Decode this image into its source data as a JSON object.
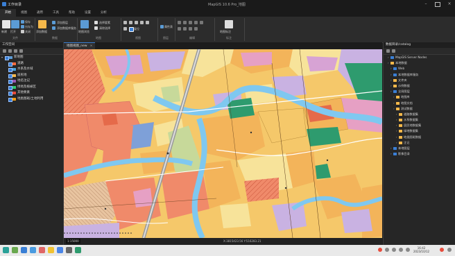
{
  "window": {
    "app_title": "工作目录",
    "doc_title": "MapGIS 10.6 Pro_地图"
  },
  "ribbon_tabs": [
    {
      "label": "开始",
      "active": true
    },
    {
      "label": "视图"
    },
    {
      "label": "通用"
    },
    {
      "label": "工具"
    },
    {
      "label": "帮助"
    },
    {
      "label": "设置"
    },
    {
      "label": "分析"
    }
  ],
  "ribbon": {
    "g1": {
      "btn1": "新建",
      "btn2": "打开",
      "s1": "保存",
      "s2": "另存为",
      "s3": "关闭",
      "name": "文件"
    },
    "g2": {
      "btn1": "添加数据",
      "s1": "添加图层",
      "s2": "添加数据库服务",
      "name": "数据"
    },
    "g3": {
      "btn1": "地图浏览",
      "s1": "选择要素",
      "s2": "清除选择",
      "name": "地图"
    },
    "g4": {
      "s1": "放大",
      "s2": "缩小",
      "s3": "复位",
      "name": "视图"
    },
    "g5": {
      "btn1": "属性表",
      "name": "图层"
    },
    "g6": {
      "name": "编辑"
    },
    "g7": {
      "btn1": "地图标注",
      "name": "标注"
    }
  },
  "left_panel": {
    "title": "工作空间",
    "map_name": "新地图",
    "layers": [
      {
        "label": "道路",
        "color": "#ff6b3d"
      },
      {
        "label": "水系及水域",
        "color": "#4aa3df"
      },
      {
        "label": "居民地",
        "color": "#f5b84a"
      },
      {
        "label": "地名注记",
        "color": "#9b59b6"
      },
      {
        "label": "绿地及植被区",
        "color": "#2ecc71"
      },
      {
        "label": "其他要素",
        "color": "#e74c3c"
      },
      {
        "label": "地类图斑/土地利用",
        "color": "#f39c12"
      }
    ]
  },
  "map": {
    "tab_label": "地图视图_new",
    "scale": "1:15000",
    "coords": "X:3815423.56 Y:516283.21"
  },
  "right_panel": {
    "title": "数据目录/catalog",
    "items": [
      {
        "label": "MapGIS Server Nodes",
        "indent": 1,
        "color": "#3a7fd5"
      },
      {
        "label": "本地数据",
        "indent": 1,
        "color": "#f5b84a"
      },
      {
        "label": "Web",
        "indent": 2,
        "color": "#3a7fd5"
      },
      {
        "label": "本地数据库服务",
        "indent": 2,
        "color": "#3a7fd5"
      },
      {
        "label": "文件夹",
        "indent": 2,
        "color": "#f5b84a"
      },
      {
        "label": "示例数据",
        "indent": 2,
        "color": "#f5b84a"
      },
      {
        "label": "全局图层",
        "indent": 2,
        "color": "#3a7fd5"
      },
      {
        "label": "地图库",
        "indent": 3,
        "color": "#f5b84a"
      },
      {
        "label": "地图文档",
        "indent": 3,
        "color": "#f5b84a"
      },
      {
        "label": "测试数据",
        "indent": 3,
        "color": "#f5b84a"
      },
      {
        "label": "道路数据集",
        "indent": 4,
        "color": "#f5b84a"
      },
      {
        "label": "水系数据集",
        "indent": 4,
        "color": "#f5b84a"
      },
      {
        "label": "居民地数据集",
        "indent": 4,
        "color": "#f5b84a"
      },
      {
        "label": "绿地数据集",
        "indent": 4,
        "color": "#f5b84a"
      },
      {
        "label": "地类图斑数据",
        "indent": 4,
        "color": "#f5b84a"
      },
      {
        "label": "注记",
        "indent": 4,
        "color": "#f5b84a"
      },
      {
        "label": "本地图层",
        "indent": 2,
        "color": "#3a7fd5"
      },
      {
        "label": "影像目录",
        "indent": 2,
        "color": "#3a7fd5"
      }
    ]
  },
  "taskbar": {
    "time": "16:42",
    "date": "2023/10/12"
  }
}
